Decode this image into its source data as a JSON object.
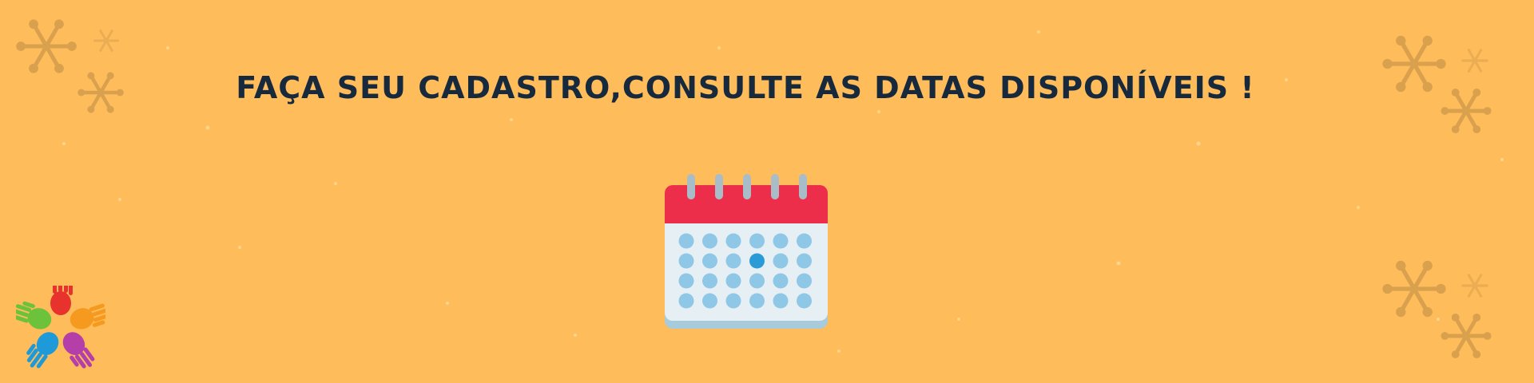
{
  "headline": "FAÇA SEU CADASTRO,CONSULTE AS DATAS DISPONÍVEIS !",
  "colors": {
    "background": "#FFBC5A",
    "headline": "#17293D",
    "calendar_header": "#EC2E4A",
    "calendar_body": "#E6EFF3",
    "calendar_dot": "#8FC7E6",
    "calendar_dot_selected": "#2B9BD7",
    "snowflake": "#D9A04E"
  },
  "calendar": {
    "icon": "calendar-icon",
    "columns": 6,
    "rows": 4,
    "highlighted_day": 10
  },
  "decorations": {
    "snowflake_icon": "snowflake-icon",
    "logo_icon": "colorful-hands-logo"
  }
}
